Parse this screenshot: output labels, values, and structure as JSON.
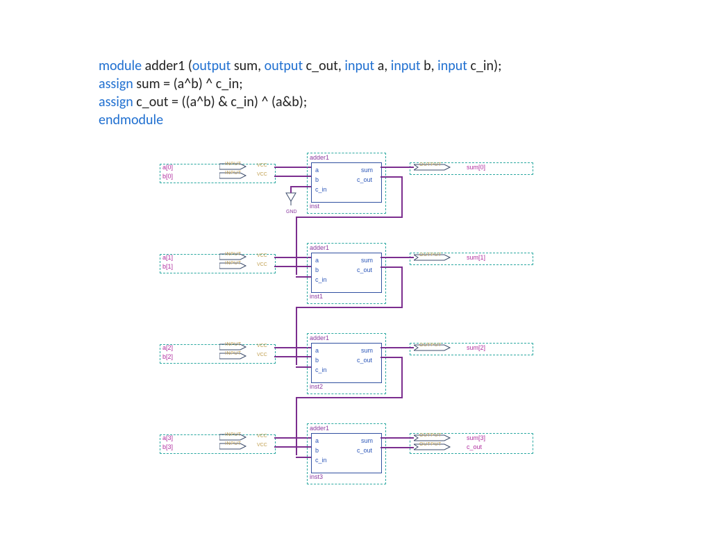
{
  "code": {
    "line1": {
      "kw1": "module",
      "plain1": " adder1 (",
      "kw2": "output",
      "plain2": " sum, ",
      "kw3": "output",
      "plain3": " c_out, ",
      "kw4": "input",
      "plain4": " a, ",
      "kw5": "input",
      "plain5": " b, ",
      "kw6": "input",
      "plain6": " c_in);"
    },
    "line2": {
      "kw": "assign",
      "plain": " sum = (a^b) ^ c_in;"
    },
    "line3": {
      "kw": "assign",
      "plain": " c_out = ((a^b) & c_in) ^ (a&b);"
    },
    "line4": {
      "kw": "endmodule"
    }
  },
  "io": {
    "input_tag": "INPUT",
    "output_tag": "OUTPUT",
    "vcc": "VCC",
    "gnd": "GND"
  },
  "adder": {
    "title": "adder1",
    "ports": {
      "a": "a",
      "b": "b",
      "c_in": "c_in",
      "sum": "sum",
      "c_out": "c_out"
    }
  },
  "stages": [
    {
      "a": "a[0]",
      "b": "b[0]",
      "inst": "inst",
      "out": "sum[0]",
      "extra_out": null,
      "has_gnd": true
    },
    {
      "a": "a[1]",
      "b": "b[1]",
      "inst": "inst1",
      "out": "sum[1]",
      "extra_out": null,
      "has_gnd": false
    },
    {
      "a": "a[2]",
      "b": "b[2]",
      "inst": "inst2",
      "out": "sum[2]",
      "extra_out": null,
      "has_gnd": false
    },
    {
      "a": "a[3]",
      "b": "b[3]",
      "inst": "inst3",
      "out": "sum[3]",
      "extra_out": "c_out",
      "has_gnd": false
    }
  ]
}
